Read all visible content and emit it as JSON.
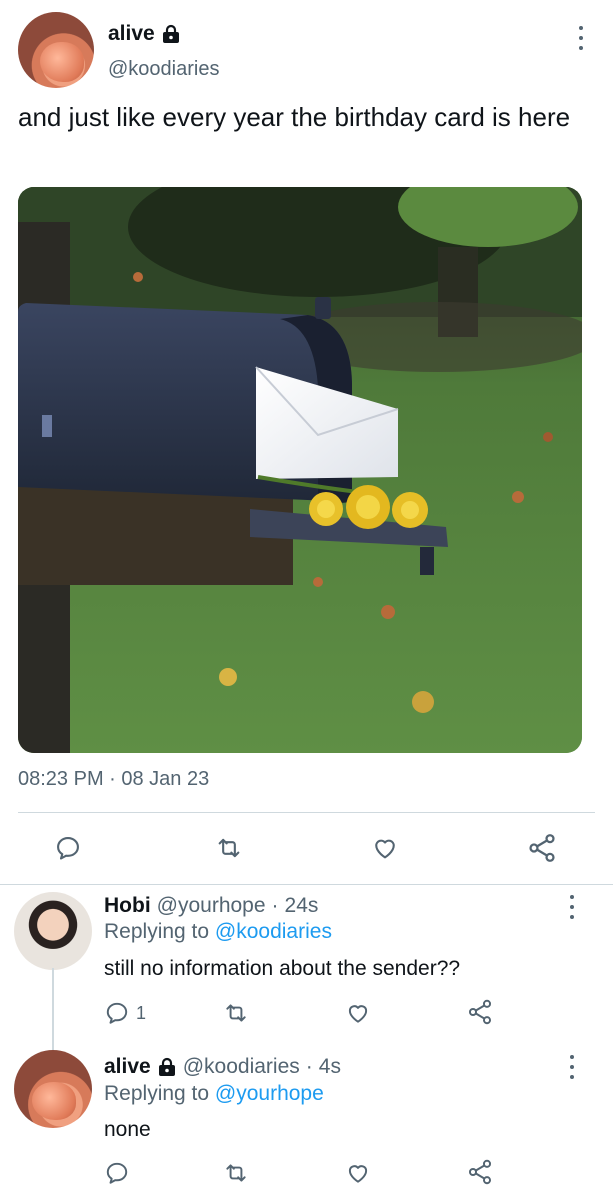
{
  "main_tweet": {
    "display_name": "alive",
    "handle": "@koodiaries",
    "text": "and just like every year the birthday card is here",
    "timestamp": "08:23 PM · 08 Jan 23",
    "media_alt": "black mailbox with white envelope and yellow roses"
  },
  "replies": [
    {
      "display_name": "Hobi",
      "handle": "@yourhope",
      "time": "24s",
      "replying_prefix": "Replying to",
      "replying_to": "@koodiaries",
      "text": "still no information about the sender??",
      "reply_count": "1"
    },
    {
      "display_name": "alive",
      "handle": "@koodiaries",
      "time": "4s",
      "replying_prefix": "Replying to",
      "replying_to": "@yourhope",
      "text": "none"
    }
  ],
  "separator": "·",
  "icons": {
    "lock": "lock-icon",
    "more": "more-vertical-icon",
    "reply": "reply-icon",
    "retweet": "retweet-icon",
    "like": "heart-icon",
    "share": "share-icon"
  },
  "colors": {
    "text": "#0f1419",
    "secondary": "#536471",
    "link": "#1d9bf0",
    "divider": "#cfd9de"
  }
}
